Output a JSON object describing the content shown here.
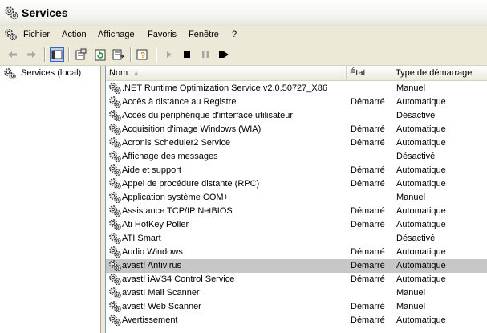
{
  "window": {
    "title": "Services"
  },
  "menu": [
    "Fichier",
    "Action",
    "Affichage",
    "Favoris",
    "Fenêtre",
    "?"
  ],
  "tree": {
    "root_label": "Services (local)"
  },
  "columns": {
    "name": "Nom",
    "state": "État",
    "startup": "Type de démarrage"
  },
  "services": [
    {
      "name": ".NET Runtime Optimization Service v2.0.50727_X86",
      "state": "",
      "startup": "Manuel"
    },
    {
      "name": "Accès à distance au Registre",
      "state": "Démarré",
      "startup": "Automatique"
    },
    {
      "name": "Accès du périphérique d'interface utilisateur",
      "state": "",
      "startup": "Désactivé"
    },
    {
      "name": "Acquisition d'image Windows (WIA)",
      "state": "Démarré",
      "startup": "Automatique"
    },
    {
      "name": "Acronis Scheduler2 Service",
      "state": "Démarré",
      "startup": "Automatique"
    },
    {
      "name": "Affichage des messages",
      "state": "",
      "startup": "Désactivé"
    },
    {
      "name": "Aide et support",
      "state": "Démarré",
      "startup": "Automatique"
    },
    {
      "name": "Appel de procédure distante (RPC)",
      "state": "Démarré",
      "startup": "Automatique"
    },
    {
      "name": "Application système COM+",
      "state": "",
      "startup": "Manuel"
    },
    {
      "name": "Assistance TCP/IP NetBIOS",
      "state": "Démarré",
      "startup": "Automatique"
    },
    {
      "name": "Ati HotKey Poller",
      "state": "Démarré",
      "startup": "Automatique"
    },
    {
      "name": "ATI Smart",
      "state": "",
      "startup": "Désactivé"
    },
    {
      "name": "Audio Windows",
      "state": "Démarré",
      "startup": "Automatique"
    },
    {
      "name": "avast! Antivirus",
      "state": "Démarré",
      "startup": "Automatique",
      "selected": true
    },
    {
      "name": "avast! iAVS4 Control Service",
      "state": "Démarré",
      "startup": "Automatique"
    },
    {
      "name": "avast! Mail Scanner",
      "state": "",
      "startup": "Manuel"
    },
    {
      "name": "avast! Web Scanner",
      "state": "Démarré",
      "startup": "Manuel"
    },
    {
      "name": "Avertissement",
      "state": "Démarré",
      "startup": "Automatique"
    }
  ],
  "icons": {
    "window": "services-gear-icon",
    "toolbar": [
      "back-arrow-icon",
      "forward-arrow-icon",
      "show-hide-tree-icon",
      "properties-icon",
      "refresh-icon",
      "export-list-icon",
      "help-icon",
      "start-service-icon",
      "stop-service-icon",
      "pause-service-icon",
      "restart-service-icon"
    ]
  },
  "colors": {
    "selected_row": "#c7c7c7",
    "window_bg": "#ece9d8"
  }
}
